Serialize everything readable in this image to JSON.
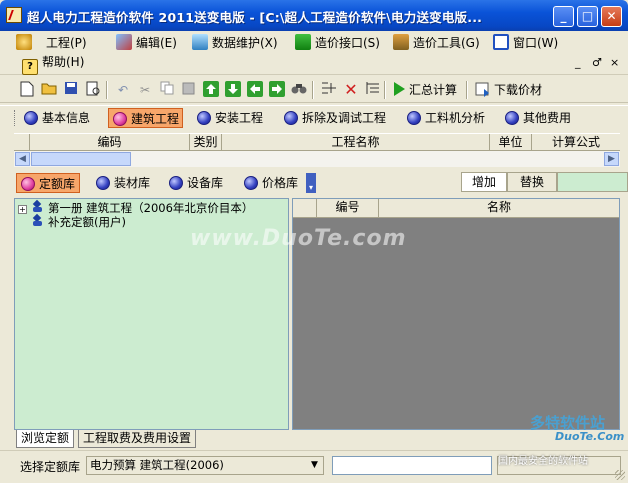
{
  "window": {
    "title": "超人电力工程造价软件 2011送变电版 - [C:\\超人工程造价软件\\电力送变电版...",
    "minimize": "_",
    "maximize": "□",
    "close": "✕"
  },
  "menu": {
    "items": [
      {
        "label": "工程(P)",
        "icon": "gear-icon"
      },
      {
        "label": "编辑(E)",
        "icon": "pencil-icon"
      },
      {
        "label": "数据维护(X)",
        "icon": "database-icon"
      },
      {
        "label": "造价接口(S)",
        "icon": "arrow-down-icon"
      },
      {
        "label": "造价工具(G)",
        "icon": "tools-icon"
      },
      {
        "label": "窗口(W)",
        "icon": "window-icon"
      },
      {
        "label": "帮助(H)",
        "icon": "help-icon"
      }
    ],
    "child_controls": [
      "_",
      "♂",
      "×"
    ]
  },
  "toolbar": {
    "summary_label": "汇总计算",
    "download_label": "下载价材"
  },
  "tabs": [
    {
      "label": "基本信息",
      "active": false
    },
    {
      "label": "建筑工程",
      "active": true
    },
    {
      "label": "安装工程",
      "active": false
    },
    {
      "label": "拆除及调试工程",
      "active": false
    },
    {
      "label": "工料机分析",
      "active": false
    },
    {
      "label": "其他费用",
      "active": false
    }
  ],
  "grid": {
    "columns": [
      "编码",
      "类别",
      "工程名称",
      "单位",
      "计算公式"
    ]
  },
  "library": {
    "tabs": [
      {
        "label": "定额库",
        "active": true
      },
      {
        "label": "装材库",
        "active": false
      },
      {
        "label": "设备库",
        "active": false
      },
      {
        "label": "价格库",
        "active": false
      }
    ],
    "add_label": "增加",
    "replace_label": "替换"
  },
  "tree": {
    "items": [
      {
        "label": "第一册 建筑工程（2006年北京价目本）",
        "expander": "+"
      },
      {
        "label": "补充定额(用户)",
        "expander": ""
      }
    ]
  },
  "right_table": {
    "columns": [
      "编号",
      "名称"
    ]
  },
  "bottom_tabs": [
    {
      "label": "浏览定额",
      "active": true
    },
    {
      "label": "工程取费及费用设置",
      "active": false
    }
  ],
  "status": {
    "label": "选择定额库",
    "selected": "电力预算 建筑工程(2006)"
  },
  "watermarks": {
    "main": "www.DuoTe.com",
    "brand": "多特软件站",
    "site": "DuoTe.Com",
    "slogan": "国内最安全的软件站"
  },
  "colors": {
    "accent": "#f7a66a",
    "titlebar": "#0a53d8",
    "tree_bg": "#ccecd0"
  }
}
